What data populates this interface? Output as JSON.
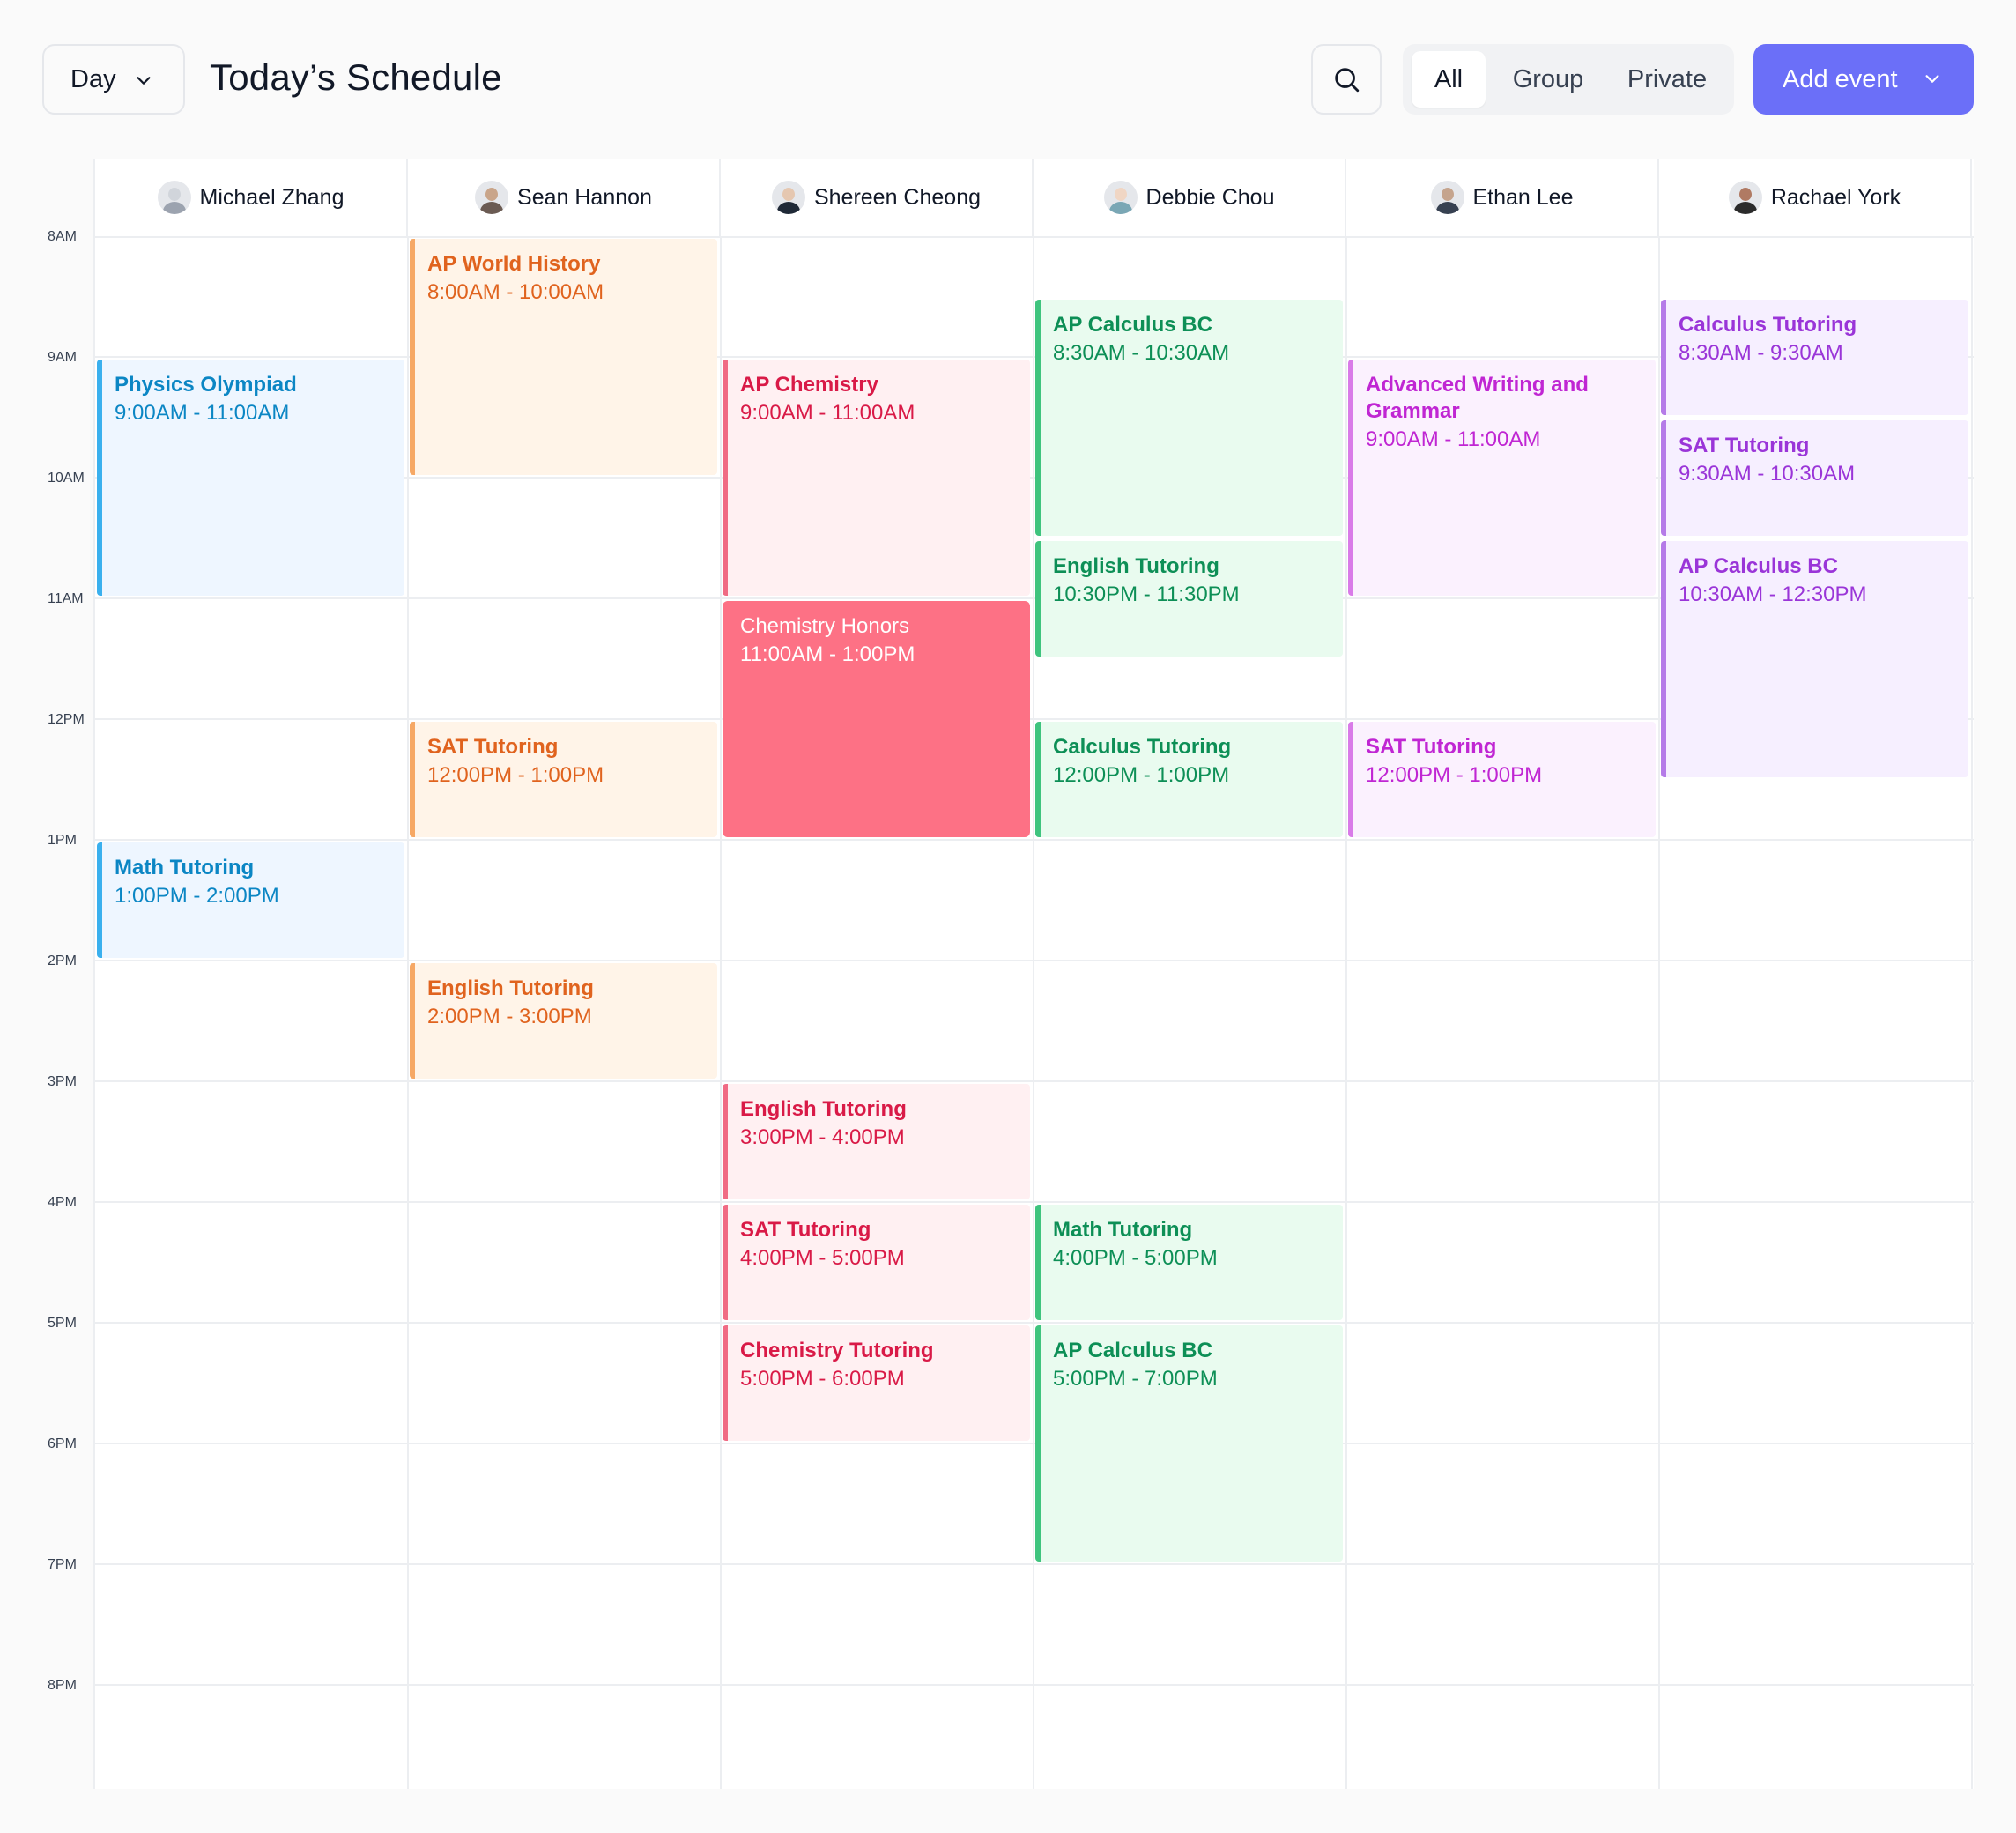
{
  "header": {
    "view_select": "Day",
    "title": "Today’s Schedule",
    "filters": [
      "All",
      "Group",
      "Private"
    ],
    "active_filter": "All",
    "add_button": "Add event"
  },
  "icons": {
    "search": "search-icon",
    "chevron": "chevron-down-icon"
  },
  "colors": {
    "accent": "#6b6ff8",
    "blue": "#3ab0ee",
    "orange": "#f6a865",
    "pink": "#f06b84",
    "green": "#3fc47e",
    "purple": "#d97be8",
    "solid_event": "#fd7185"
  },
  "time_labels": [
    "8AM",
    "9AM",
    "10AM",
    "11AM",
    "12PM",
    "1PM",
    "2PM",
    "3PM",
    "4PM",
    "5PM",
    "6PM",
    "7PM",
    "8PM"
  ],
  "columns": [
    {
      "name": "Michael Zhang",
      "color": "blue",
      "events": [
        {
          "title": "Physics Olympiad",
          "time": "9:00AM - 11:00AM"
        },
        {
          "title": "Math Tutoring",
          "time": "1:00PM - 2:00PM"
        }
      ]
    },
    {
      "name": "Sean Hannon",
      "color": "orange",
      "events": [
        {
          "title": "AP World History",
          "time": "8:00AM - 10:00AM"
        },
        {
          "title": "SAT Tutoring",
          "time": "12:00PM - 1:00PM"
        },
        {
          "title": "English Tutoring",
          "time": "2:00PM - 3:00PM"
        }
      ]
    },
    {
      "name": "Shereen Cheong",
      "color": "pink",
      "events": [
        {
          "title": "AP Chemistry",
          "time": "9:00AM - 11:00AM"
        },
        {
          "title": "Chemistry Honors",
          "time": "11:00AM - 1:00PM"
        },
        {
          "title": "English Tutoring",
          "time": "3:00PM - 4:00PM"
        },
        {
          "title": "SAT Tutoring",
          "time": "4:00PM - 5:00PM"
        },
        {
          "title": "Chemistry Tutoring",
          "time": "5:00PM - 6:00PM"
        }
      ]
    },
    {
      "name": "Debbie Chou",
      "color": "green",
      "events": [
        {
          "title": "AP Calculus BC",
          "time": "8:30AM - 10:30AM"
        },
        {
          "title": "English Tutoring",
          "time": "10:30PM - 11:30PM"
        },
        {
          "title": "Calculus Tutoring",
          "time": "12:00PM - 1:00PM"
        },
        {
          "title": "Math Tutoring",
          "time": "4:00PM - 5:00PM"
        },
        {
          "title": "AP Calculus BC",
          "time": "5:00PM - 7:00PM"
        }
      ]
    },
    {
      "name": "Ethan Lee",
      "color": "purple",
      "events": [
        {
          "title": "Advanced Writing and Grammar",
          "time": "9:00AM - 11:00AM"
        },
        {
          "title": "SAT Tutoring",
          "time": "12:00PM - 1:00PM"
        }
      ]
    },
    {
      "name": "Rachael York",
      "color": "violet",
      "events": [
        {
          "title": "Calculus Tutoring",
          "time": "8:30AM - 9:30AM"
        },
        {
          "title": "SAT Tutoring",
          "time": "9:30AM - 10:30AM"
        },
        {
          "title": "AP Calculus BC",
          "time": "10:30AM - 12:30PM"
        }
      ]
    }
  ]
}
